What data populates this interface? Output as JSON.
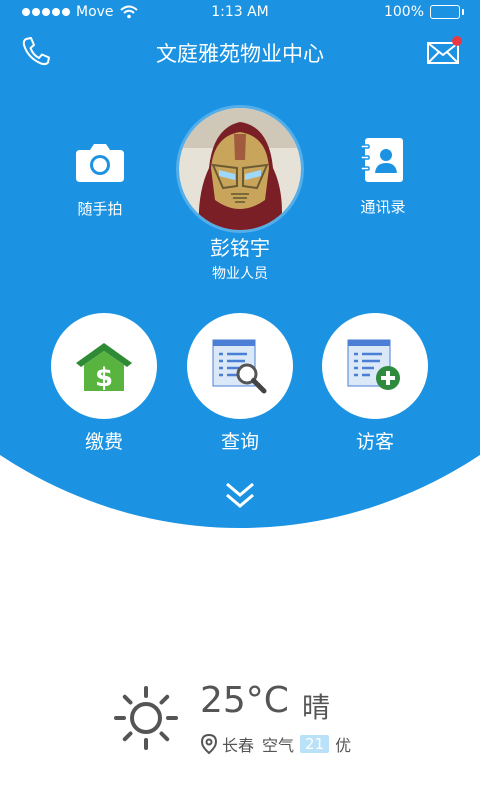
{
  "status_bar": {
    "carrier": "Move",
    "time": "1:13 AM",
    "battery": "100%"
  },
  "header": {
    "title": "文庭雅苑物业中心"
  },
  "quick_actions": {
    "camera_label": "随手拍",
    "contacts_label": "通讯录"
  },
  "profile": {
    "name": "彭铭宇",
    "role": "物业人员"
  },
  "features": {
    "pay_label": "缴费",
    "query_label": "查询",
    "visitor_label": "访客"
  },
  "weather": {
    "temperature": "25°C",
    "condition": "晴",
    "city": "长春",
    "air_label": "空气",
    "aqi": "21",
    "air_quality": "优"
  },
  "colors": {
    "primary": "#1b93e2",
    "notification": "#e63a44",
    "pay_green": "#3a9b3f",
    "doc_blue": "#4b7fd6"
  },
  "icons": [
    "phone-icon",
    "mail-icon",
    "camera-icon",
    "contacts-icon",
    "house-dollar-icon",
    "document-search-icon",
    "document-add-icon",
    "double-chevron-down-icon",
    "sun-icon",
    "location-pin-icon"
  ]
}
